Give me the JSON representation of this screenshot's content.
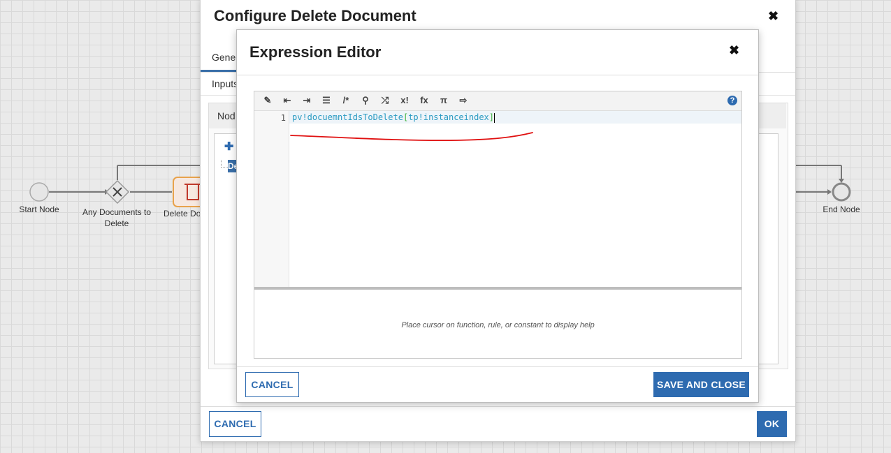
{
  "canvas": {
    "start_node_label": "Start Node",
    "gateway_label_line1": "Any Documents to",
    "gateway_label_line2": "Delete",
    "delete_node_label": "Delete Do",
    "end_node_label": "End Node"
  },
  "outer_dialog": {
    "title": "Configure Delete Document",
    "close_icon": "close-icon",
    "tab_general": "Gene",
    "tab_inputs": "Inputs",
    "node_header": "Nod",
    "tree_add_icon": "plus-icon",
    "tree_selected_text": "De",
    "cancel_label": "CANCEL",
    "ok_label": "OK"
  },
  "expression_editor": {
    "title": "Expression Editor",
    "close_icon": "close-icon",
    "toolbar": [
      {
        "name": "magic-wand-icon",
        "glyph": "✎"
      },
      {
        "name": "outdent-icon",
        "glyph": "⇤"
      },
      {
        "name": "indent-icon",
        "glyph": "⇥"
      },
      {
        "name": "format-list-icon",
        "glyph": "☰"
      },
      {
        "name": "comment-icon",
        "glyph": "/*"
      },
      {
        "name": "search-icon",
        "glyph": "⚲"
      },
      {
        "name": "shuffle-icon",
        "glyph": "⤮"
      },
      {
        "name": "rule-icon",
        "glyph": "x!"
      },
      {
        "name": "function-icon",
        "glyph": "fx"
      },
      {
        "name": "constant-icon",
        "glyph": "π"
      },
      {
        "name": "export-icon",
        "glyph": "⇨"
      }
    ],
    "help_icon": "help-icon",
    "line_number": "1",
    "code": {
      "part1": "pv!docuemntIdsToDelete",
      "bracket_open": "[",
      "part2": "tp!instanceindex",
      "bracket_close": "]"
    },
    "help_text": "Place cursor on function, rule, or constant to display help",
    "cancel_label": "CANCEL",
    "save_label": "SAVE AND CLOSE",
    "annotation_color": "#e01010"
  }
}
